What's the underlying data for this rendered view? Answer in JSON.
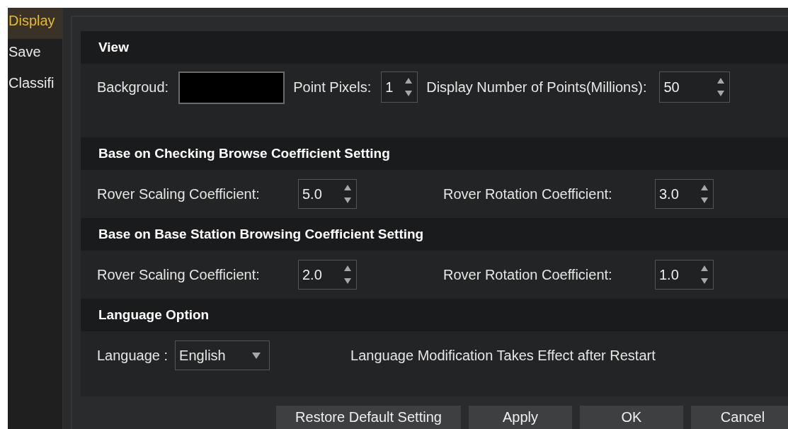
{
  "sidebar": {
    "items": [
      {
        "label": "Display",
        "selected": true
      },
      {
        "label": "Save",
        "selected": false
      },
      {
        "label": "Classifi",
        "selected": false
      }
    ]
  },
  "sections": [
    {
      "title": "View",
      "kind": "view",
      "background_label": "Backgroud:",
      "point_pixels_label": "Point Pixels:",
      "point_pixels": "1",
      "points_label": "Display Number of Points(Millions):",
      "points": "50"
    },
    {
      "title": "Base on Checking Browse Coefficient Setting",
      "kind": "coefficients",
      "scaling_label": "Rover Scaling Coefficient:",
      "scaling": "5.0",
      "rotation_label": "Rover Rotation Coefficient:",
      "rotation": "3.0"
    },
    {
      "title": "Base on Base Station Browsing Coefficient Setting",
      "kind": "coefficients",
      "scaling_label": "Rover Scaling Coefficient:",
      "scaling": "2.0",
      "rotation_label": "Rover Rotation Coefficient:",
      "rotation": "1.0"
    },
    {
      "title": "Language Option",
      "kind": "language",
      "language_label": "Language :",
      "language": "English",
      "note": "Language Modification Takes Effect after Restart"
    }
  ],
  "buttons": [
    "Restore Default Setting",
    "Apply",
    "OK",
    "Cancel"
  ]
}
